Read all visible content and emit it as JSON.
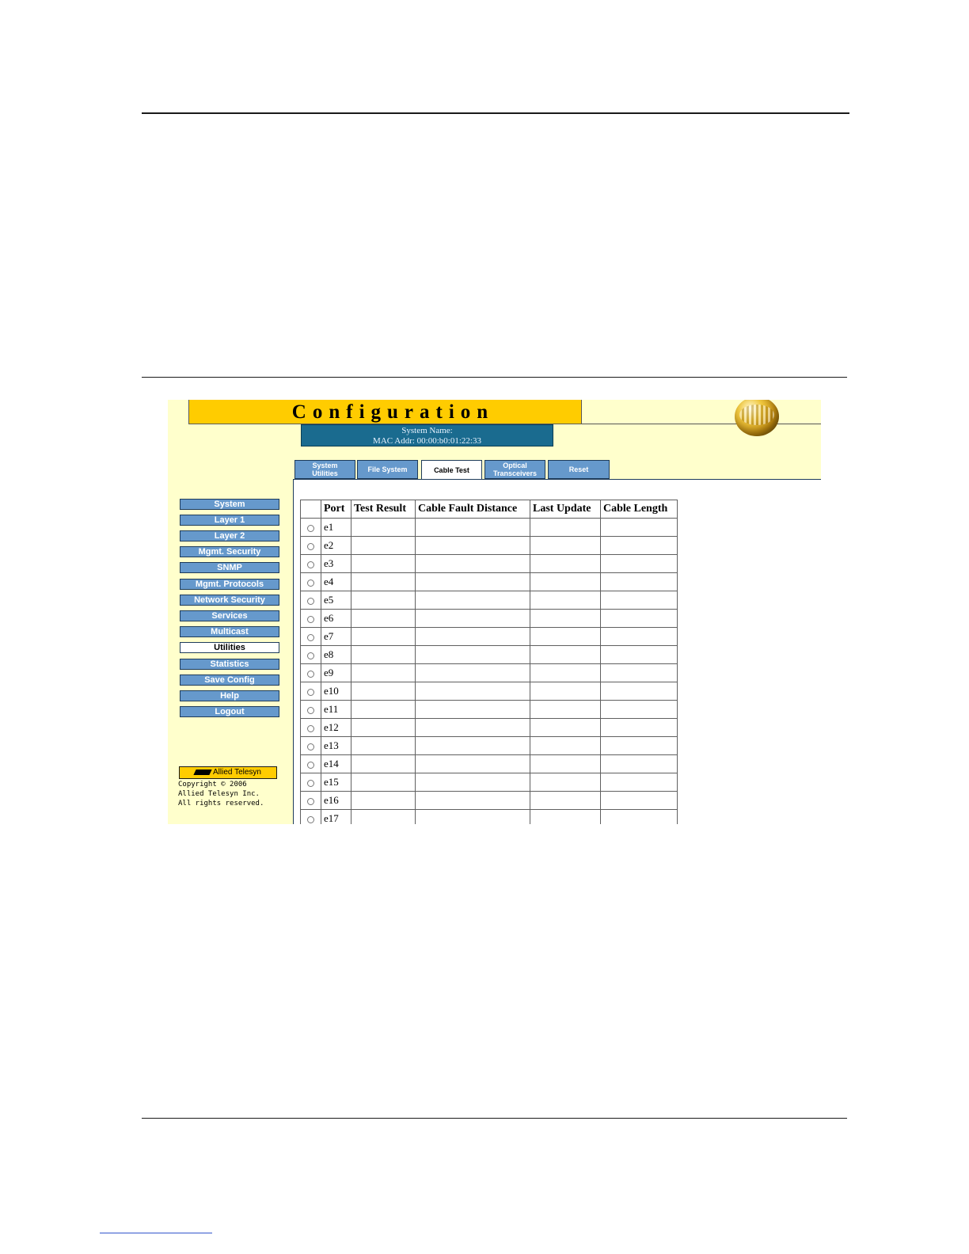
{
  "app": {
    "title": "Configuration",
    "system_name_label": "System Name:",
    "mac_addr_label": "MAC Addr:",
    "mac_addr_value": "00:00:b0:01:22:33"
  },
  "tabs": [
    {
      "label_line1": "System",
      "label_line2": "Utilities",
      "active": false
    },
    {
      "label_line1": "File System",
      "label_line2": "",
      "active": false
    },
    {
      "label_line1": "Cable Test",
      "label_line2": "",
      "active": true
    },
    {
      "label_line1": "Optical",
      "label_line2": "Transceivers",
      "active": false
    },
    {
      "label_line1": "Reset",
      "label_line2": "",
      "active": false
    }
  ],
  "sidebar": {
    "items": [
      {
        "label": "System"
      },
      {
        "label": "Layer 1"
      },
      {
        "label": "Layer 2"
      },
      {
        "label": "Mgmt. Security"
      },
      {
        "label": "SNMP"
      },
      {
        "label": "Mgmt. Protocols"
      },
      {
        "label": "Network Security"
      },
      {
        "label": "Services"
      },
      {
        "label": "Multicast"
      },
      {
        "label": "Utilities",
        "active": true
      },
      {
        "label": "Statistics"
      },
      {
        "label": "Save Config"
      },
      {
        "label": "Help"
      },
      {
        "label": "Logout"
      }
    ],
    "logo_text": "Allied Telesyn",
    "copyright_lines": [
      "Copyright © 2006",
      "Allied Telesyn Inc.",
      "All rights reserved."
    ]
  },
  "table": {
    "headers": [
      "Port",
      "Test Result",
      "Cable Fault Distance",
      "Last Update",
      "Cable Length"
    ],
    "rows": [
      {
        "port": "e1"
      },
      {
        "port": "e2"
      },
      {
        "port": "e3"
      },
      {
        "port": "e4"
      },
      {
        "port": "e5"
      },
      {
        "port": "e6"
      },
      {
        "port": "e7"
      },
      {
        "port": "e8"
      },
      {
        "port": "e9"
      },
      {
        "port": "e10"
      },
      {
        "port": "e11"
      },
      {
        "port": "e12"
      },
      {
        "port": "e13"
      },
      {
        "port": "e14"
      },
      {
        "port": "e15"
      },
      {
        "port": "e16"
      },
      {
        "port": "e17"
      }
    ]
  },
  "colors": {
    "page_bg": "#ffffcc",
    "title_bar": "#ffcc00",
    "info_box": "#1a6b8f",
    "menu_button": "#6699cc"
  },
  "icons": [
    "globe-logo-icon",
    "allied-telesyn-logo-icon",
    "radio-icon"
  ]
}
